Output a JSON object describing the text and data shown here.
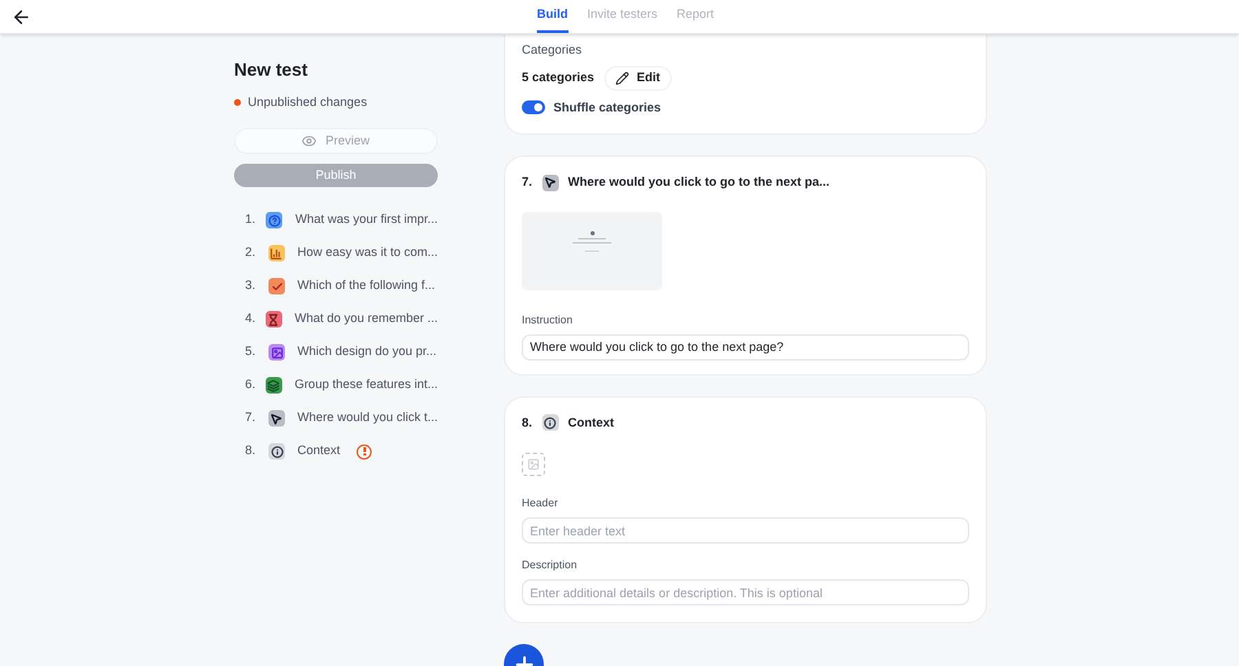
{
  "tabs": [
    {
      "label": "Build",
      "selected": true
    },
    {
      "label": "Invite testers",
      "selected": false
    },
    {
      "label": "Report",
      "selected": false
    }
  ],
  "test": {
    "title": "New test",
    "status": "Unpublished changes",
    "preview": "Preview",
    "publish": "Publish"
  },
  "questions": [
    {
      "number": "1.",
      "kind": "question",
      "color": "#5b9cf0",
      "label": "What was your first impr...",
      "warning": false
    },
    {
      "number": "2.",
      "kind": "bars",
      "color": "#f7c35f",
      "label": "How easy was it to com...",
      "warning": false
    },
    {
      "number": "3.",
      "kind": "check",
      "color": "#f08a5d",
      "label": "Which of the following f...",
      "warning": false
    },
    {
      "number": "4.",
      "kind": "hourglass",
      "color": "#e8677a",
      "label": "What do you remember ...",
      "warning": false
    },
    {
      "number": "5.",
      "kind": "image",
      "color": "#b78bf0",
      "label": "Which design do you pr...",
      "warning": false
    },
    {
      "number": "6.",
      "kind": "sort",
      "color": "#3a9a4a",
      "label": "Group these features int...",
      "warning": false
    },
    {
      "number": "7.",
      "kind": "cursor",
      "color": "#b9bcc2",
      "label": "Where would you click t...",
      "warning": false
    },
    {
      "number": "8.",
      "kind": "info",
      "color": "#d6d8dc",
      "label": "Context",
      "warning": true
    }
  ],
  "categories_card": {
    "label": "Categories",
    "count": "5 categories",
    "edit": "Edit",
    "shuffle": {
      "label": "Shuffle categories",
      "on": true
    }
  },
  "click_card": {
    "number": "7.",
    "kind": "cursor",
    "title": "Where would you click to go to the next pa...",
    "instruction_label": "Instruction",
    "instruction_value": "Where would you click to go to the next page?"
  },
  "context_card": {
    "number": "8.",
    "kind": "info",
    "title": "Context",
    "header_label": "Header",
    "header_placeholder": "Enter header text",
    "description_label": "Description",
    "description_placeholder": "Enter additional details or description. This is optional"
  }
}
